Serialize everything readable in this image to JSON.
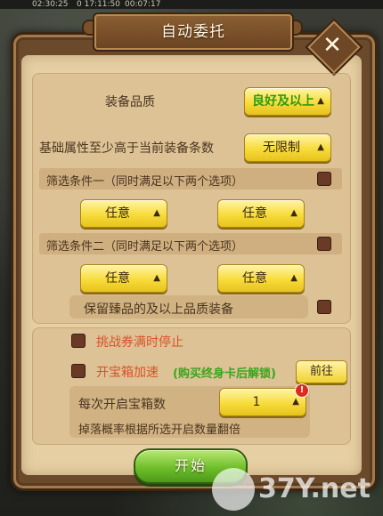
{
  "status_bar": {
    "left": "02:30:25",
    "mid1": "0 17:11:50",
    "mid2": "00:07:17"
  },
  "dialog": {
    "title": "自动委托",
    "close_label": "✕"
  },
  "quality": {
    "label": "装备品质",
    "value": "良好及以上",
    "arrow": "▲"
  },
  "base_attr": {
    "label": "基础属性至少高于当前装备条数",
    "value": "无限制",
    "arrow": "▲"
  },
  "filter1": {
    "label": "筛选条件一（同时满足以下两个选项）",
    "option_a": "任意",
    "option_b": "任意",
    "arrow": "▲"
  },
  "filter2": {
    "label": "筛选条件二（同时满足以下两个选项）",
    "option_a": "任意",
    "option_b": "任意",
    "arrow": "▲"
  },
  "keep_rare": {
    "label": "保留臻品的及以上品质装备"
  },
  "stop_full": {
    "label": "挑战券满时停止"
  },
  "chest_speed": {
    "label": "开宝箱加速",
    "note": "(购买终身卡后解锁)",
    "go_label": "前往"
  },
  "chest_count": {
    "label": "每次开启宝箱数",
    "value": "1",
    "arrow": "▲",
    "badge": "!",
    "hint": "掉落概率根据所选开启数量翻倍"
  },
  "start_label": "开始",
  "watermark": "37Y.net",
  "colors": {
    "frame": "#6b4a2c",
    "panel": "#e6cfa3",
    "dropdown": "#f7dc3a",
    "start": "#6fbe2b",
    "red_label": "#d8532b",
    "green_note": "#3aa61d"
  }
}
